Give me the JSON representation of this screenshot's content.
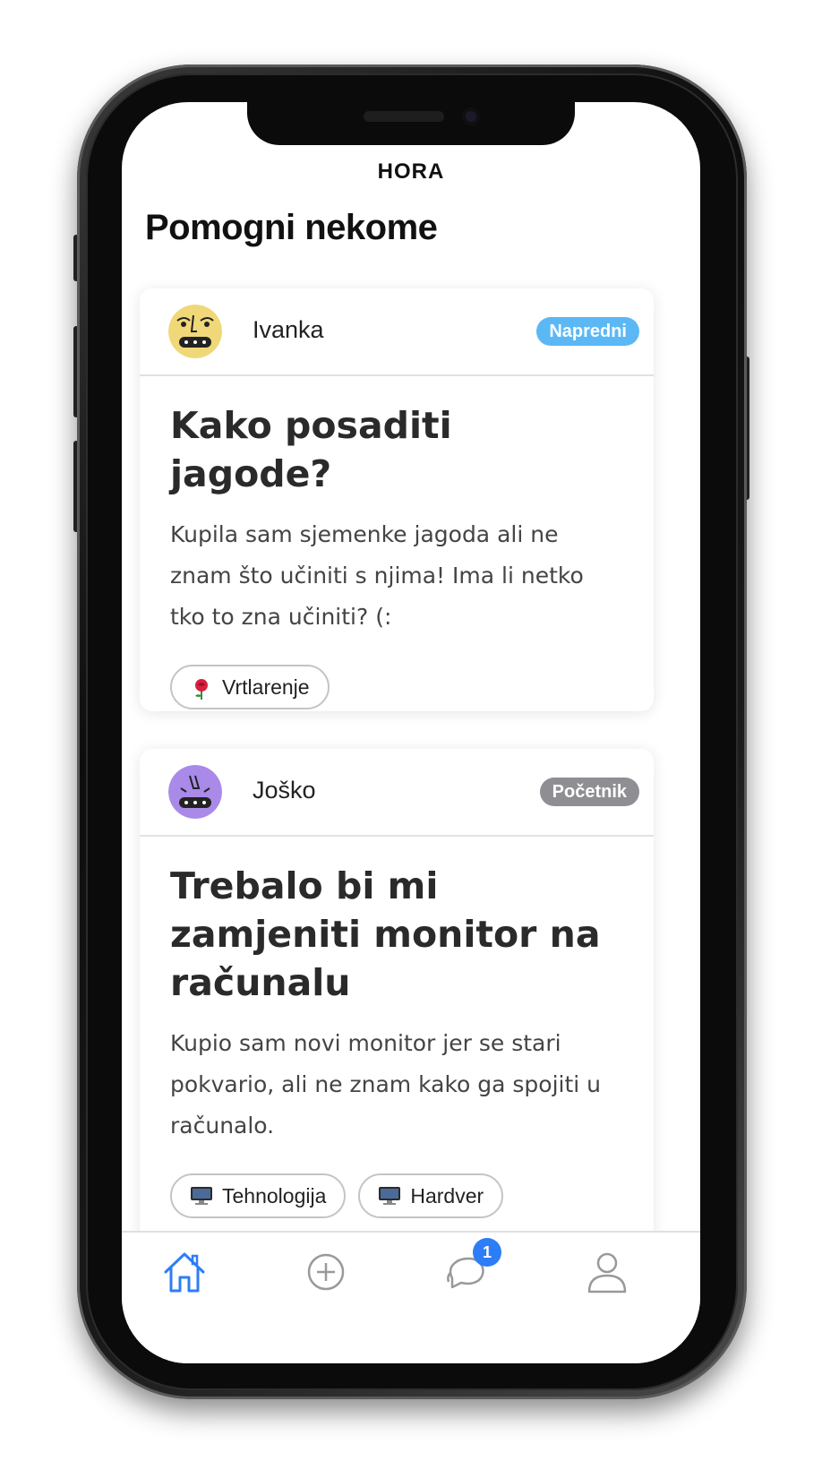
{
  "app": {
    "title": "HORA"
  },
  "page": {
    "title": "Pomogni nekome"
  },
  "posts": [
    {
      "author": "Ivanka",
      "level": "Napredni",
      "level_color": "#5bb8f5",
      "avatar_color": "#f0d878",
      "title": "Kako posaditi jagode?",
      "text": "Kupila sam sjemenke jagoda ali ne znam što učiniti s njima! Ima li netko tko to zna učiniti? (:",
      "tags": [
        {
          "icon": "rose-icon",
          "label": "Vrtlarenje"
        }
      ]
    },
    {
      "author": "Joško",
      "level": "Početnik",
      "level_color": "#8e8e93",
      "avatar_color": "#a98ae8",
      "title": "Trebalo bi mi zamjeniti monitor na računalu",
      "text": "Kupio sam novi monitor jer se stari pokvario, ali ne znam kako ga spojiti u računalo.",
      "tags": [
        {
          "icon": "computer-icon",
          "label": "Tehnologija"
        },
        {
          "icon": "computer-icon",
          "label": "Hardver"
        }
      ]
    }
  ],
  "tabbar": {
    "items": [
      "home-icon",
      "add-icon",
      "chat-icon",
      "profile-icon"
    ],
    "active": "home",
    "active_color": "#2d7df6",
    "messages_badge": "1"
  }
}
